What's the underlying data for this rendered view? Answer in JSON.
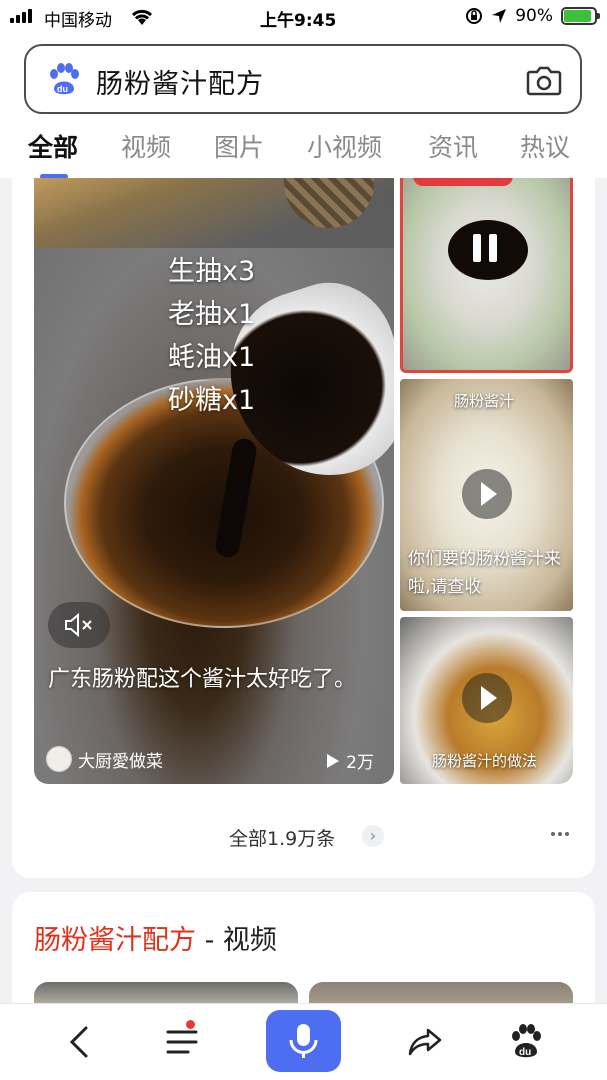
{
  "status_bar": {
    "carrier": "中国移动",
    "time": "上午9:45",
    "battery": "90%",
    "battery_level": 0.9,
    "icons": [
      "signal-icon",
      "wifi-icon",
      "orientation-lock-icon",
      "location-arrow-icon",
      "battery-charging-icon"
    ]
  },
  "search": {
    "query": "肠粉酱汁配方",
    "icons": [
      "baidu-paw-icon",
      "camera-icon"
    ]
  },
  "tabs": [
    {
      "label": "全部",
      "active": true
    },
    {
      "label": "视频",
      "active": false
    },
    {
      "label": "图片",
      "active": false
    },
    {
      "label": "小视频",
      "active": false
    },
    {
      "label": "资讯",
      "active": false
    },
    {
      "label": "热议",
      "active": false
    }
  ],
  "featured_video": {
    "overlay_lines": [
      "生抽x3",
      "老抽x1",
      "蚝油x1",
      "砂糖x1"
    ],
    "title": "广东肠粉配这个酱汁太好吃了。",
    "author": "大厨愛做菜",
    "plays": "2万"
  },
  "side_videos": [
    {
      "overlay": "",
      "state": "playing"
    },
    {
      "overlay_top": "肠粉酱汁",
      "overlay_bottom": "你们要的肠粉酱汁来啦,请查收"
    },
    {
      "overlay_bottom": "肠粉酱汁的做法"
    }
  ],
  "more": {
    "label": "全部1.9万条"
  },
  "video_section": {
    "title_highlight": "肠粉酱汁配方",
    "title_suffix": " - 视频"
  },
  "colors": {
    "accent_blue": "#4e6ef2",
    "highlight_red": "#e0311a",
    "border_red": "#e0463e"
  }
}
